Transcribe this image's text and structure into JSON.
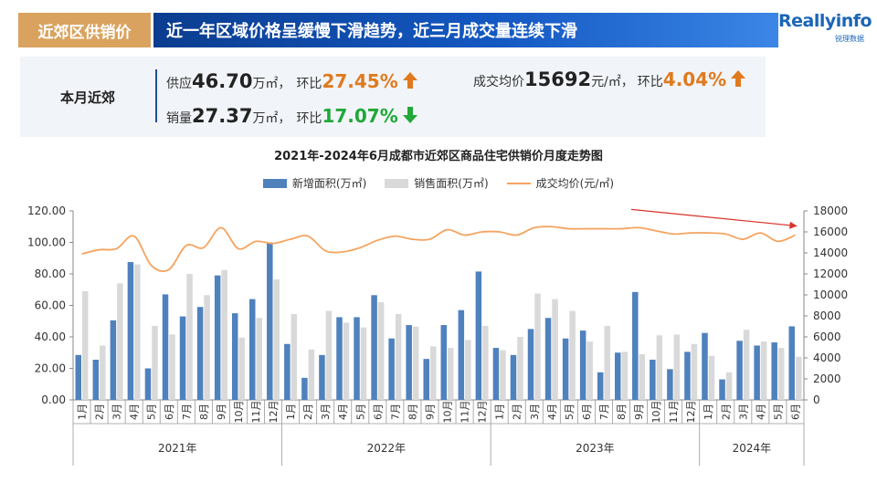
{
  "header": {
    "tag": "近郊区供销价",
    "title": "近一年区域价格呈缓慢下滑趋势，近三月成交量连续下滑",
    "logo_text": "Reallyinfo",
    "logo_sub": "锐理数据"
  },
  "summary": {
    "label": "本月近郊",
    "supply_prefix": "供应",
    "supply_value": "46.70",
    "supply_unit": "万㎡，",
    "supply_mom_prefix": "环比",
    "supply_mom": "27.45%",
    "sales_prefix": "销量",
    "sales_value": "27.37",
    "sales_unit": "万㎡，",
    "sales_mom_prefix": "环比",
    "sales_mom": "17.07%",
    "price_prefix": "成交均价",
    "price_value": "15692",
    "price_unit": "元/㎡，",
    "price_mom_prefix": "环比",
    "price_mom": "4.04%",
    "colors": {
      "up": "#e07a1f",
      "down": "#20a838"
    }
  },
  "chart_data": {
    "type": "bar",
    "title": "2021年-2024年6月成都市近郊区商品住宅供销价月度走势图",
    "legend_position": "top",
    "categories": [
      "1月",
      "2月",
      "3月",
      "4月",
      "5月",
      "6月",
      "7月",
      "8月",
      "9月",
      "10月",
      "11月",
      "12月",
      "1月",
      "2月",
      "3月",
      "4月",
      "5月",
      "6月",
      "7月",
      "8月",
      "9月",
      "10月",
      "11月",
      "12月",
      "1月",
      "2月",
      "3月",
      "4月",
      "5月",
      "6月",
      "7月",
      "8月",
      "9月",
      "10月",
      "11月",
      "12月",
      "1月",
      "2月",
      "3月",
      "4月",
      "5月",
      "6月"
    ],
    "year_groups": [
      {
        "label": "2021年",
        "count": 12
      },
      {
        "label": "2022年",
        "count": 12
      },
      {
        "label": "2023年",
        "count": 12
      },
      {
        "label": "2024年",
        "count": 6
      }
    ],
    "y_left": {
      "min": 0,
      "max": 120,
      "ticks": [
        "0.00",
        "20.00",
        "40.00",
        "60.00",
        "80.00",
        "100.00",
        "120.00"
      ]
    },
    "y_right": {
      "min": 0,
      "max": 18000,
      "ticks": [
        "0",
        "2000",
        "4000",
        "6000",
        "8000",
        "10000",
        "12000",
        "14000",
        "16000",
        "18000"
      ]
    },
    "grid": false,
    "series": [
      {
        "name": "新增面积(万㎡)",
        "type": "bar",
        "color": "#4f81bd",
        "axis": "left",
        "values": [
          28.5,
          25.5,
          50.5,
          87.5,
          20.0,
          67.0,
          53.0,
          59.0,
          79.0,
          55.0,
          64.0,
          100.0,
          35.5,
          14.0,
          28.5,
          52.5,
          52.5,
          66.5,
          39.0,
          47.5,
          26.0,
          47.5,
          57.0,
          81.5,
          33.0,
          28.5,
          45.0,
          52.0,
          39.0,
          44.0,
          17.5,
          30.0,
          68.5,
          25.5,
          19.5,
          30.5,
          42.5,
          13.0,
          37.5,
          34.5,
          36.5,
          46.7
        ]
      },
      {
        "name": "销售面积(万㎡)",
        "type": "bar",
        "color": "#d9d9d9",
        "axis": "left",
        "values": [
          69.0,
          34.5,
          74.0,
          86.0,
          47.0,
          41.5,
          80.0,
          66.5,
          82.5,
          39.5,
          52.0,
          76.5,
          54.5,
          32.0,
          56.5,
          49.0,
          46.0,
          62.0,
          54.5,
          46.5,
          34.0,
          33.0,
          38.0,
          47.0,
          31.5,
          40.0,
          67.5,
          64.0,
          56.5,
          37.0,
          47.0,
          30.5,
          29.0,
          41.0,
          41.5,
          35.5,
          28.0,
          17.5,
          44.5,
          37.0,
          33.0,
          27.37
        ]
      },
      {
        "name": "成交均价(元/㎡)",
        "type": "line",
        "color": "#f4a460",
        "axis": "right",
        "values": [
          13900,
          14300,
          14400,
          15600,
          12800,
          12400,
          14700,
          14500,
          16400,
          14400,
          15100,
          14900,
          15300,
          15600,
          14200,
          14100,
          14500,
          15200,
          15600,
          15300,
          15300,
          16200,
          15700,
          16000,
          16000,
          15700,
          16400,
          16500,
          16300,
          16300,
          16300,
          16300,
          16400,
          16100,
          15800,
          15900,
          15900,
          15800,
          15300,
          15900,
          15100,
          15692
        ]
      }
    ],
    "annotation": {
      "type": "trend-arrow",
      "color": "#d9312a",
      "from_index": 32,
      "to_index": 41
    }
  }
}
